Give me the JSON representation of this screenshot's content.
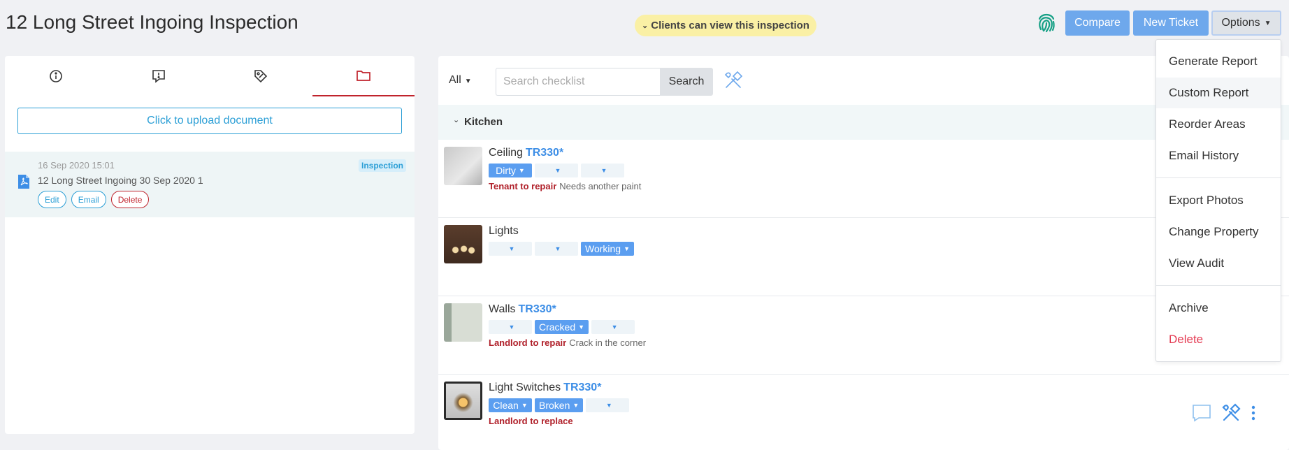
{
  "header": {
    "title": "12 Long Street Ingoing Inspection",
    "clients_notice": "Clients can view this inspection",
    "compare_label": "Compare",
    "new_ticket_label": "New Ticket",
    "options_label": "Options"
  },
  "left_panel": {
    "tabs": [
      {
        "icon": "info-icon"
      },
      {
        "icon": "comment-icon"
      },
      {
        "icon": "tag-icon"
      },
      {
        "icon": "folder-icon",
        "active": true
      }
    ],
    "upload_label": "Click to upload document",
    "document": {
      "date": "16 Sep 2020 15:01",
      "name": "12 Long Street Ingoing 30 Sep 2020 1",
      "badge": "Inspection",
      "actions": {
        "edit": "Edit",
        "email": "Email",
        "delete": "Delete"
      }
    }
  },
  "checklist": {
    "filter": "All",
    "search_placeholder": "Search checklist",
    "search_label": "Search",
    "area": "Kitchen",
    "items": [
      {
        "name": "Ceiling",
        "code": "TR330*",
        "chips": [
          "Dirty",
          "",
          ""
        ],
        "responsibility": "Tenant to repair",
        "note": "Needs another paint"
      },
      {
        "name": "Lights",
        "code": "",
        "chips": [
          "",
          "",
          "Working"
        ],
        "responsibility": "",
        "note": ""
      },
      {
        "name": "Walls",
        "code": "TR330*",
        "chips": [
          "",
          "Cracked",
          ""
        ],
        "responsibility": "Landlord to repair",
        "note": "Crack in the corner"
      },
      {
        "name": "Light Switches",
        "code": "TR330*",
        "chips": [
          "Clean",
          "Broken",
          ""
        ],
        "responsibility": "Landlord to replace",
        "note": ""
      }
    ]
  },
  "options_menu": {
    "items": [
      "Generate Report",
      "Custom Report",
      "Reorder Areas",
      "Email History",
      "Export Photos",
      "Change Property",
      "View Audit",
      "Archive",
      "Delete"
    ],
    "highlighted": "Custom Report"
  },
  "colors": {
    "accent": "#6ea8ec",
    "brand_red": "#c0232c",
    "notice_bg": "#faf0a5",
    "fingerprint": "#16a085",
    "danger": "#e43a52"
  }
}
